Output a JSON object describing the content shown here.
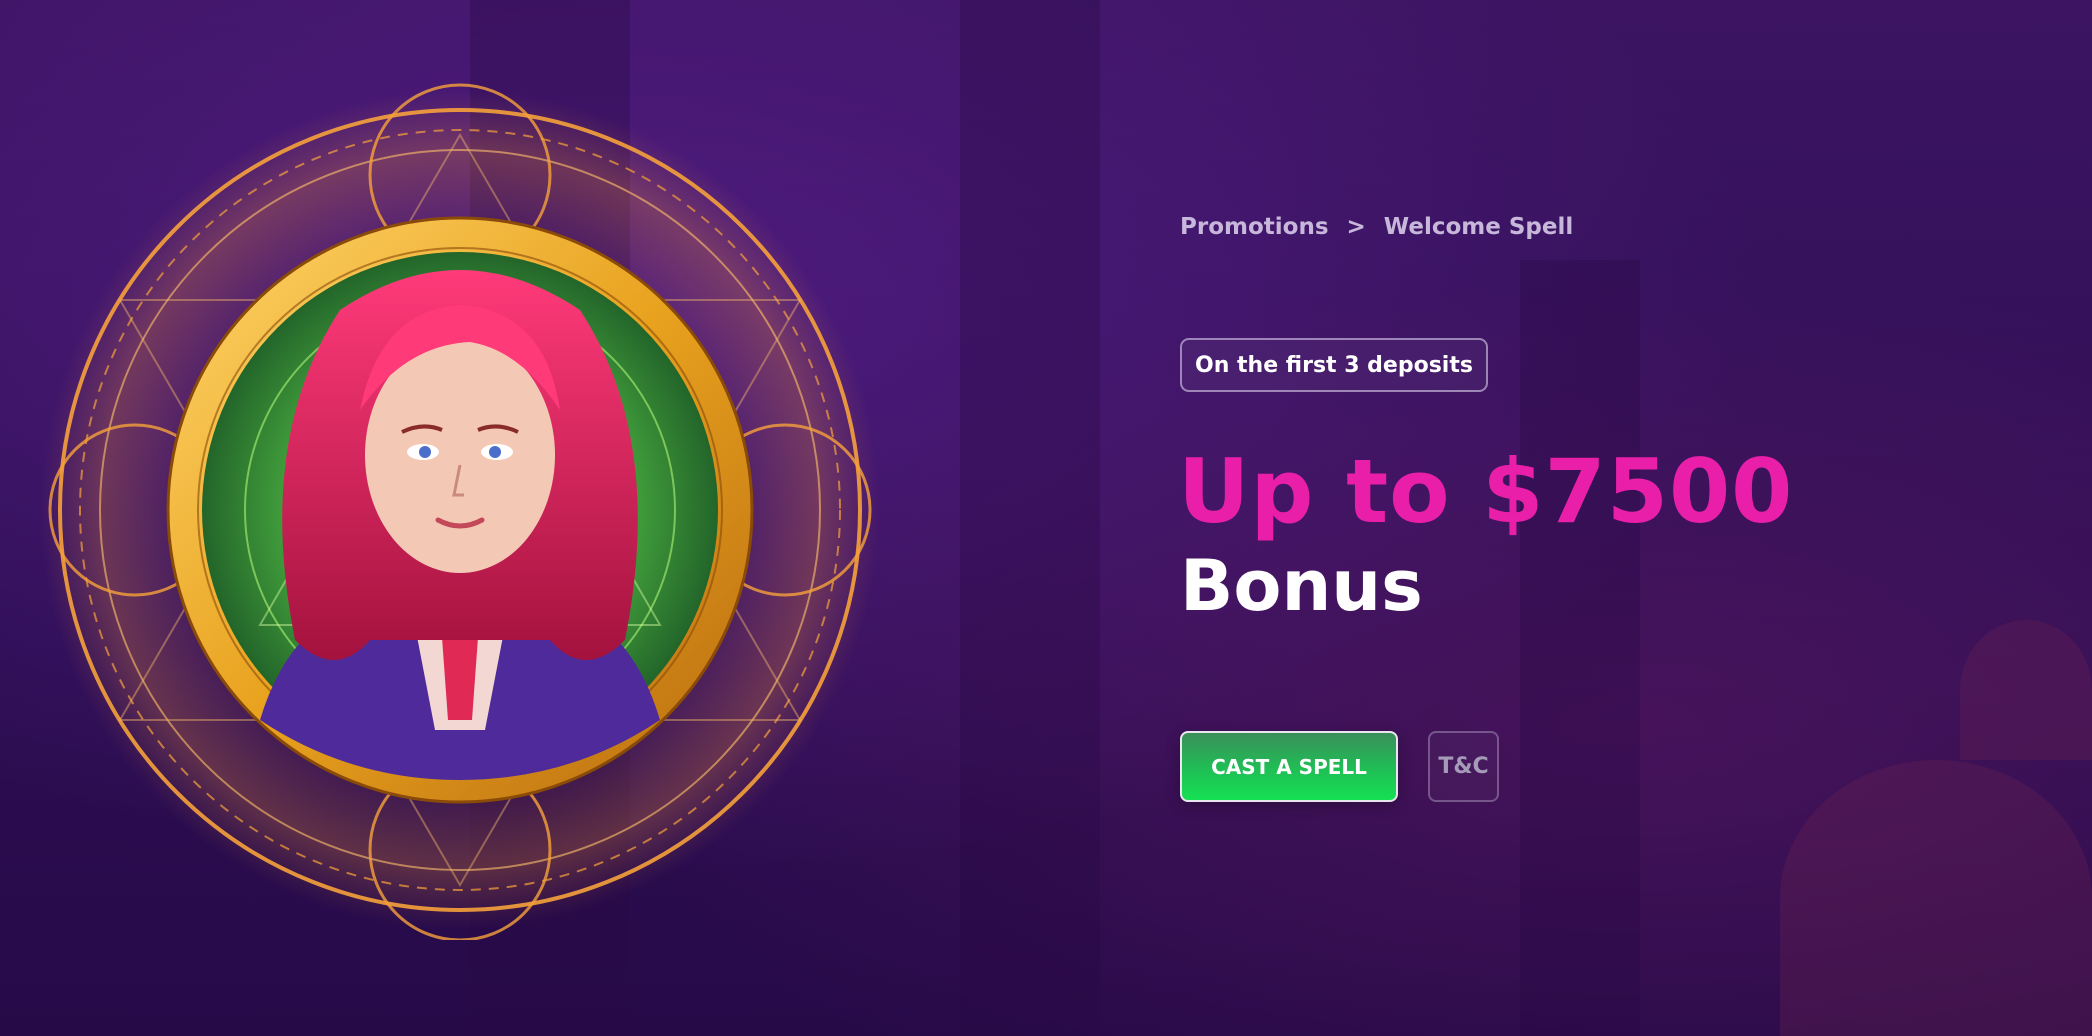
{
  "breadcrumb": {
    "parent": "Promotions",
    "separator": ">",
    "current": "Welcome Spell"
  },
  "promo": {
    "badge": "On the first 3 deposits",
    "amount": "Up to $7500",
    "bonus_label": "Bonus",
    "cta_label": "CAST A SPELL",
    "terms_label": "T&C"
  },
  "colors": {
    "accent_pink": "#ea1fa9",
    "cta_green": "#16e054",
    "background": "#2f0f55"
  },
  "icons": {
    "hero": "wizard-portrait-medallion"
  }
}
